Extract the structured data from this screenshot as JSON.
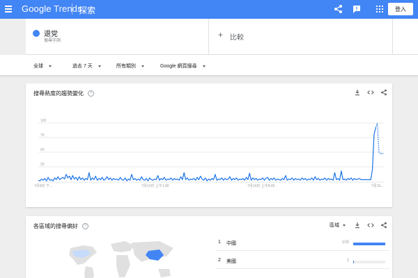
{
  "header": {
    "brand_google": "Google",
    "brand_trends": "Trends",
    "title": "探索",
    "signin_label": "登入"
  },
  "search_term": {
    "name": "退党",
    "type": "搜尋字詞",
    "color": "#4285f4",
    "compare_label": "比較"
  },
  "filters": {
    "region": "全球",
    "time": "過去 7 天",
    "category": "所有類別",
    "source": "Google 網頁搜尋"
  },
  "interest_card": {
    "title": "搜尋熱度的趨勢變化"
  },
  "region_card": {
    "title": "各區域的搜尋偏好",
    "select_label": "區域",
    "rows": [
      {
        "rank": "1",
        "name": "中國",
        "value": 100
      },
      {
        "rank": "2",
        "name": "美國",
        "value": 1
      }
    ]
  },
  "chart_data": {
    "type": "line",
    "ylim": [
      0,
      100
    ],
    "yticks": [
      "100",
      "75",
      "50",
      "25"
    ],
    "xtick_labels": [
      "7月9日 下...",
      "7月13日 上午1:00",
      "7月14日 上午8:00",
      "7月16..."
    ],
    "xtick_positions": [
      0,
      7,
      14,
      27
    ],
    "line_color": "#1a73e8",
    "grid": true,
    "series": [
      {
        "values": [
          2,
          1,
          4,
          2,
          5,
          1,
          7,
          2,
          3,
          1,
          6,
          3,
          8,
          3,
          5,
          7,
          4,
          12,
          6,
          9,
          3,
          10,
          4,
          7,
          2,
          8,
          3,
          6,
          2,
          5,
          3,
          15,
          2,
          6,
          3,
          9,
          2,
          5,
          3,
          7,
          2,
          4,
          8,
          3,
          6,
          2,
          5,
          3,
          4,
          2,
          7,
          3,
          2,
          6,
          1,
          4,
          2,
          12,
          3,
          5,
          2,
          4,
          2,
          8,
          3,
          2,
          5,
          1,
          6,
          3,
          2,
          4,
          3,
          10,
          2,
          5,
          3,
          7,
          2,
          4,
          3,
          6,
          2,
          5,
          3,
          4,
          2,
          8,
          3,
          15,
          3,
          6,
          2,
          4,
          3,
          5,
          2,
          7,
          3,
          9,
          4,
          2,
          6,
          1,
          4,
          2,
          5,
          3,
          12,
          2,
          4,
          3,
          6,
          2,
          5,
          3,
          4,
          8,
          2,
          5,
          3,
          6,
          2,
          4,
          3,
          5,
          2,
          7,
          3,
          14,
          2,
          6,
          3,
          5,
          2,
          4,
          3,
          6,
          2,
          5,
          7,
          2,
          5,
          3,
          6,
          2,
          4,
          3,
          2,
          5,
          3,
          10,
          2,
          4,
          3,
          6,
          2,
          5,
          3,
          4,
          2,
          6,
          3,
          5,
          2,
          4,
          3,
          6,
          2,
          8,
          3,
          5,
          2,
          4,
          3,
          6,
          2,
          5,
          3,
          4,
          2,
          15,
          3,
          5,
          2,
          18,
          3,
          4,
          2,
          5,
          3,
          6,
          2,
          5,
          3,
          4,
          5,
          3,
          3,
          3,
          3,
          3,
          3,
          3,
          20,
          80,
          92,
          100,
          50,
          47,
          48,
          47
        ],
        "partial_last_points": 5
      }
    ]
  },
  "region_map": {
    "land_color": "#e0e0e0",
    "highlight_color": "#4285f4",
    "light_highlight_color": "#c6dafc"
  }
}
